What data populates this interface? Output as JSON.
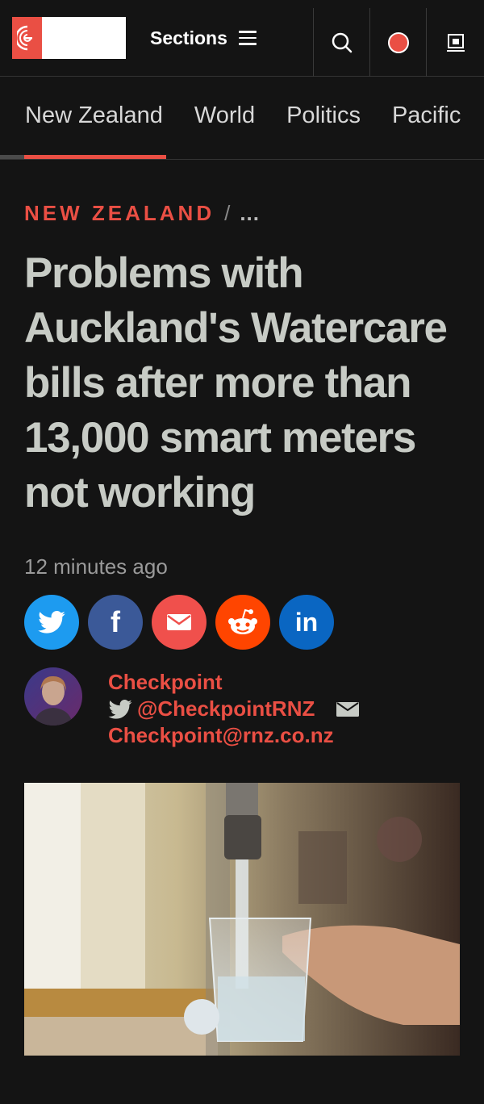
{
  "header": {
    "sections_label": "Sections"
  },
  "nav": {
    "tabs": [
      "New Zealand",
      "World",
      "Politics",
      "Pacific"
    ]
  },
  "article": {
    "section": "NEW ZEALAND",
    "separator": "/",
    "more": "...",
    "headline": "Problems with Auckland's Watercare bills after more than 13,000 smart meters not working",
    "time": "12 minutes ago",
    "author": {
      "name": "Checkpoint",
      "twitter": "@CheckpointRNZ",
      "email": "Checkpoint@rnz.co.nz"
    }
  },
  "share_icons": [
    "twitter-icon",
    "facebook-icon",
    "email-icon",
    "reddit-icon",
    "linkedin-icon"
  ],
  "colors": {
    "accent": "#ea4f44",
    "background": "#141414",
    "headline": "#c7cbc5",
    "twitter": "#1d9bf0",
    "facebook": "#3b5998",
    "email": "#f0504c",
    "reddit": "#ff4500",
    "linkedin": "#0a66c2"
  }
}
